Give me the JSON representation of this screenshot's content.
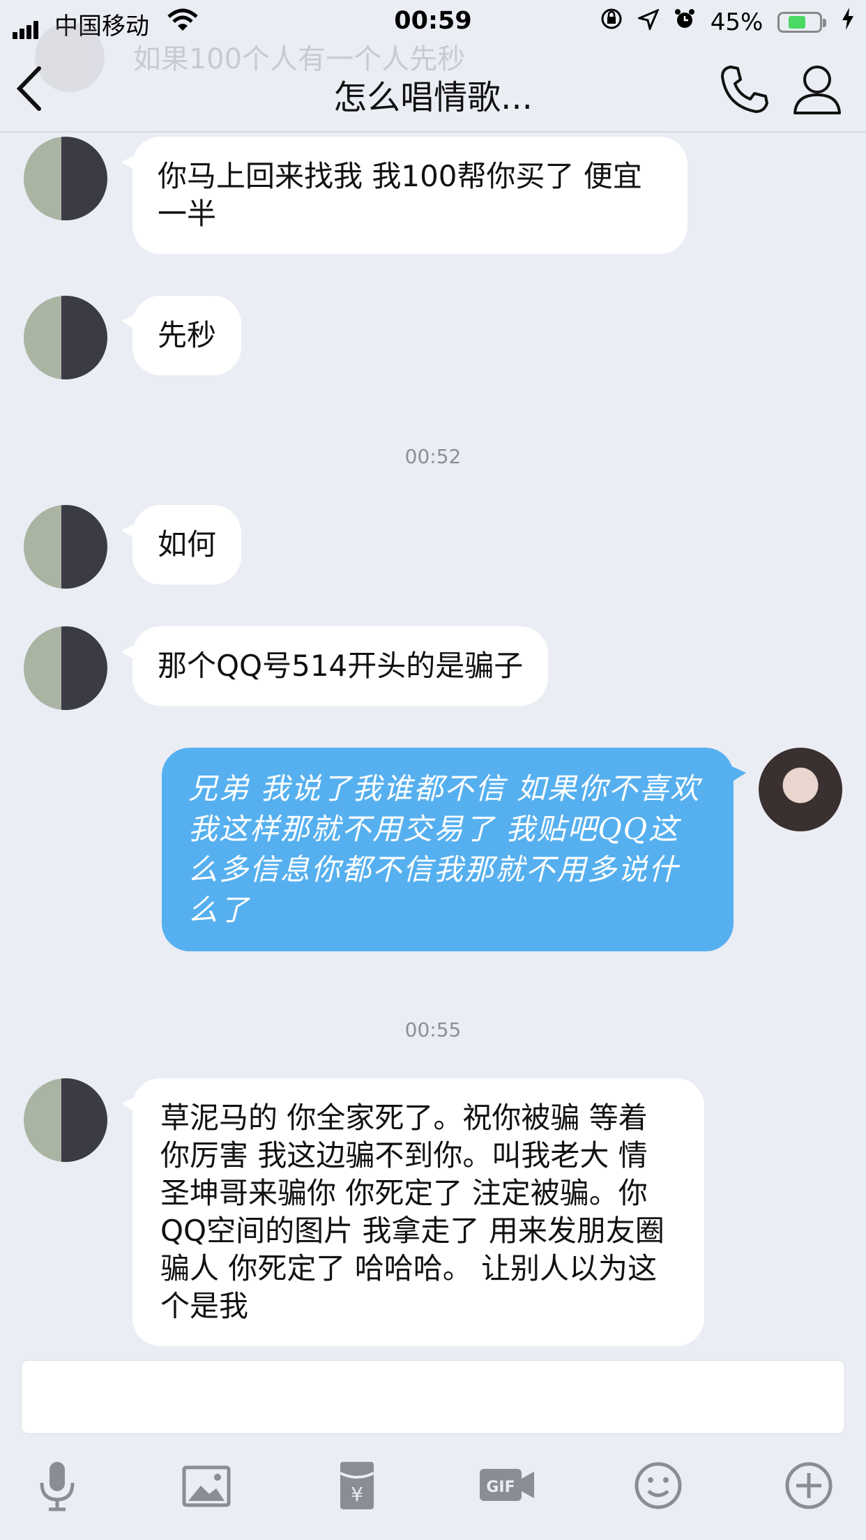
{
  "status_bar": {
    "carrier": "中国移动",
    "time": "00:59",
    "battery_percent": "45%",
    "battery_level": 0.45,
    "icons": [
      "signal-icon",
      "wifi-icon",
      "rotation-lock-icon",
      "location-icon",
      "alarm-icon",
      "battery-icon",
      "charging-icon"
    ]
  },
  "nav": {
    "title": "怎么唱情歌...",
    "ghost_preview": "如果100个人有一个人先秒",
    "icons": [
      "back-icon",
      "phone-icon",
      "profile-icon"
    ]
  },
  "messages": [
    {
      "side": "in",
      "avatar": "couple-avatar",
      "text": "你马上回来找我 我100帮你买了 便宜一半"
    },
    {
      "side": "in",
      "avatar": "couple-avatar",
      "text": "先秒"
    },
    {
      "type": "time",
      "text": "00:52"
    },
    {
      "side": "in",
      "avatar": "couple-avatar",
      "text": "如何"
    },
    {
      "side": "in",
      "avatar": "couple-avatar",
      "text": "那个QQ号514开头的是骗子"
    },
    {
      "side": "out",
      "avatar": "girl-avatar",
      "text": "兄弟 我说了我谁都不信 如果你不喜欢我这样那就不用交易了 我贴吧QQ这么多信息你都不信我那就不用多说什么了"
    },
    {
      "type": "time",
      "text": "00:55"
    },
    {
      "side": "in",
      "avatar": "couple-avatar",
      "text": "草泥马的 你全家死了。祝你被骗 等着 你厉害 我这边骗不到你。叫我老大 情圣坤哥来骗你 你死定了 注定被骗。你QQ空间的图片 我拿走了 用来发朋友圈骗人 你死定了 哈哈哈。 让别人以为这个是我"
    }
  ],
  "input": {
    "value": "",
    "placeholder": ""
  },
  "toolbar": [
    "microphone-icon",
    "image-icon",
    "red-packet-icon",
    "gif-icon",
    "emoji-icon",
    "plus-icon"
  ],
  "colors": {
    "background": "#ebedf5",
    "outgoing_bubble": "#56b0ef",
    "incoming_bubble": "#ffffff",
    "battery_fill": "#4cd964"
  }
}
